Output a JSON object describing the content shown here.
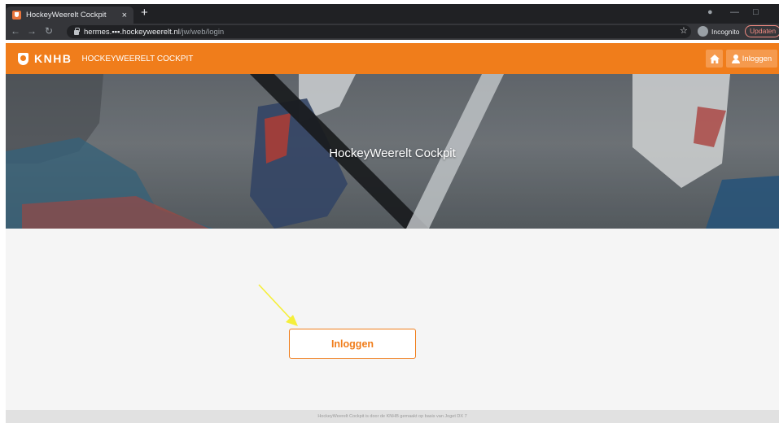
{
  "browser": {
    "tab_title": "HockeyWeerelt Cockpit",
    "tab_close": "×",
    "new_tab": "+",
    "url_host": "hermes.▪▪▪.hockeyweerelt.nl",
    "url_path": "/jw/web/login",
    "incognito_label": "Incognito",
    "update_label": "Updaten"
  },
  "header": {
    "logo_text": "KNHB",
    "app_title": "HOCKEYWEERELT COCKPIT",
    "login_label": "Inloggen"
  },
  "hero": {
    "title": "HockeyWeerelt Cockpit"
  },
  "main": {
    "login_button": "Inloggen"
  },
  "footer": {
    "text": "HockeyWeerelt Cockpit is door de KNHB gemaakt op basis van Joget DX 7"
  },
  "colors": {
    "brand": "#f07d1b",
    "chrome_dark": "#202124",
    "annotation_arrow": "#f5ef3a"
  }
}
